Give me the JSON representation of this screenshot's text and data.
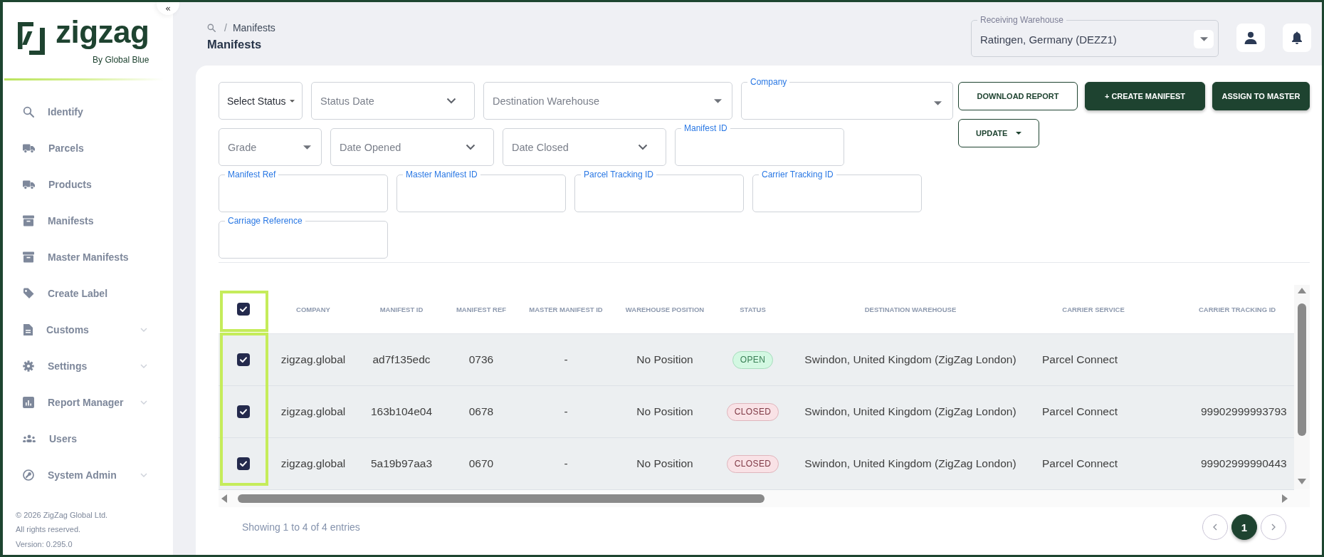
{
  "sidebar": {
    "collapse_button": "«",
    "logo": {
      "wordmark": "zigzag",
      "tagline": "By Global Blue"
    },
    "items": [
      {
        "label": "Identify",
        "selected": false,
        "has_submenu": false
      },
      {
        "label": "Parcels",
        "selected": false,
        "has_submenu": false
      },
      {
        "label": "Products",
        "selected": false,
        "has_submenu": false
      },
      {
        "label": "Manifests",
        "selected": false,
        "has_submenu": false
      },
      {
        "label": "Master Manifests",
        "selected": false,
        "has_submenu": false
      },
      {
        "label": "Create Label",
        "selected": false,
        "has_submenu": false
      },
      {
        "label": "Customs",
        "selected": false,
        "has_submenu": true
      },
      {
        "label": "Settings",
        "selected": false,
        "has_submenu": true
      },
      {
        "label": "Report Manager",
        "selected": false,
        "has_submenu": true
      },
      {
        "label": "Users",
        "selected": false,
        "has_submenu": false
      },
      {
        "label": "System Admin",
        "selected": false,
        "has_submenu": true
      }
    ],
    "footer": [
      "© 2026 ZigZag Global Ltd.",
      "All rights reserved.",
      "Version: 0.295.0"
    ]
  },
  "header": {
    "breadcrumb": {
      "separator": "/",
      "current": "Manifests"
    },
    "title": "Manifests",
    "receiving_warehouse": {
      "label": "Receiving Warehouse",
      "value": "Ratingen, Germany (DEZZ1)"
    }
  },
  "filters": [
    {
      "kind": "select",
      "label": "Select Status"
    },
    {
      "kind": "date",
      "placeholder": "Status Date"
    },
    {
      "kind": "dropdown",
      "placeholder": "Destination Warehouse"
    },
    {
      "kind": "dropdown",
      "label": "Company"
    },
    {
      "kind": "dropdown",
      "placeholder": "Grade"
    },
    {
      "kind": "date",
      "placeholder": "Date Opened"
    },
    {
      "kind": "date",
      "placeholder": "Date Closed"
    },
    {
      "kind": "text",
      "label": "Manifest ID"
    },
    {
      "kind": "text",
      "label": "Manifest Ref"
    },
    {
      "kind": "text",
      "label": "Master Manifest ID"
    },
    {
      "kind": "text",
      "label": "Parcel Tracking ID"
    },
    {
      "kind": "text",
      "label": "Carrier Tracking ID"
    },
    {
      "kind": "text",
      "label": "Carriage Reference"
    }
  ],
  "actions": [
    {
      "kind": "outlined",
      "label": "DOWNLOAD REPORT"
    },
    {
      "kind": "filled",
      "label": "+ CREATE MANIFEST"
    },
    {
      "kind": "filled",
      "label": "ASSIGN TO MASTER"
    },
    {
      "kind": "menu",
      "label": "UPDATE"
    }
  ],
  "table": {
    "select_all": {
      "checked": true
    },
    "columns": [
      "COMPANY",
      "MANIFEST ID",
      "MANIFEST REF",
      "MASTER MANIFEST ID",
      "WAREHOUSE POSITION",
      "STATUS",
      "DESTINATION WAREHOUSE",
      "CARRIER SERVICE",
      "CARRIER TRACKING ID"
    ],
    "rows": [
      {
        "selected": true,
        "company": "zigzag.global",
        "manifest_id": "ad7f135edc",
        "manifest_ref": "0736",
        "master_manifest_id": "-",
        "warehouse_position": "No Position",
        "status": {
          "label": "OPEN",
          "color": "#d3f8e2"
        },
        "destination_warehouse": "Swindon, United Kingdom (ZigZag London)",
        "carrier_service": "Parcel Connect"
      },
      {
        "selected": true,
        "company": "zigzag.global",
        "manifest_id": "163b104e04",
        "manifest_ref": "0678",
        "master_manifest_id": "-",
        "warehouse_position": "No Position",
        "status": {
          "label": "CLOSED",
          "color": "#f9e2e6"
        },
        "destination_warehouse": "Swindon, United Kingdom (ZigZag London)",
        "carrier_service": "Parcel Connect",
        "carrier_tracking_id": "99902999993793"
      },
      {
        "selected": true,
        "company": "zigzag.global",
        "manifest_id": "5a19b97aa3",
        "manifest_ref": "0670",
        "master_manifest_id": "-",
        "warehouse_position": "No Position",
        "status": {
          "label": "CLOSED",
          "color": "#f9e2e6"
        },
        "destination_warehouse": "Swindon, United Kingdom (ZigZag London)",
        "carrier_service": "Parcel Connect",
        "carrier_tracking_id": "99902999990443"
      }
    ]
  },
  "footer": {
    "entries": "Showing 1 to 4 of 4 entries",
    "pages": [
      {
        "label": "1",
        "selected": true
      }
    ]
  }
}
